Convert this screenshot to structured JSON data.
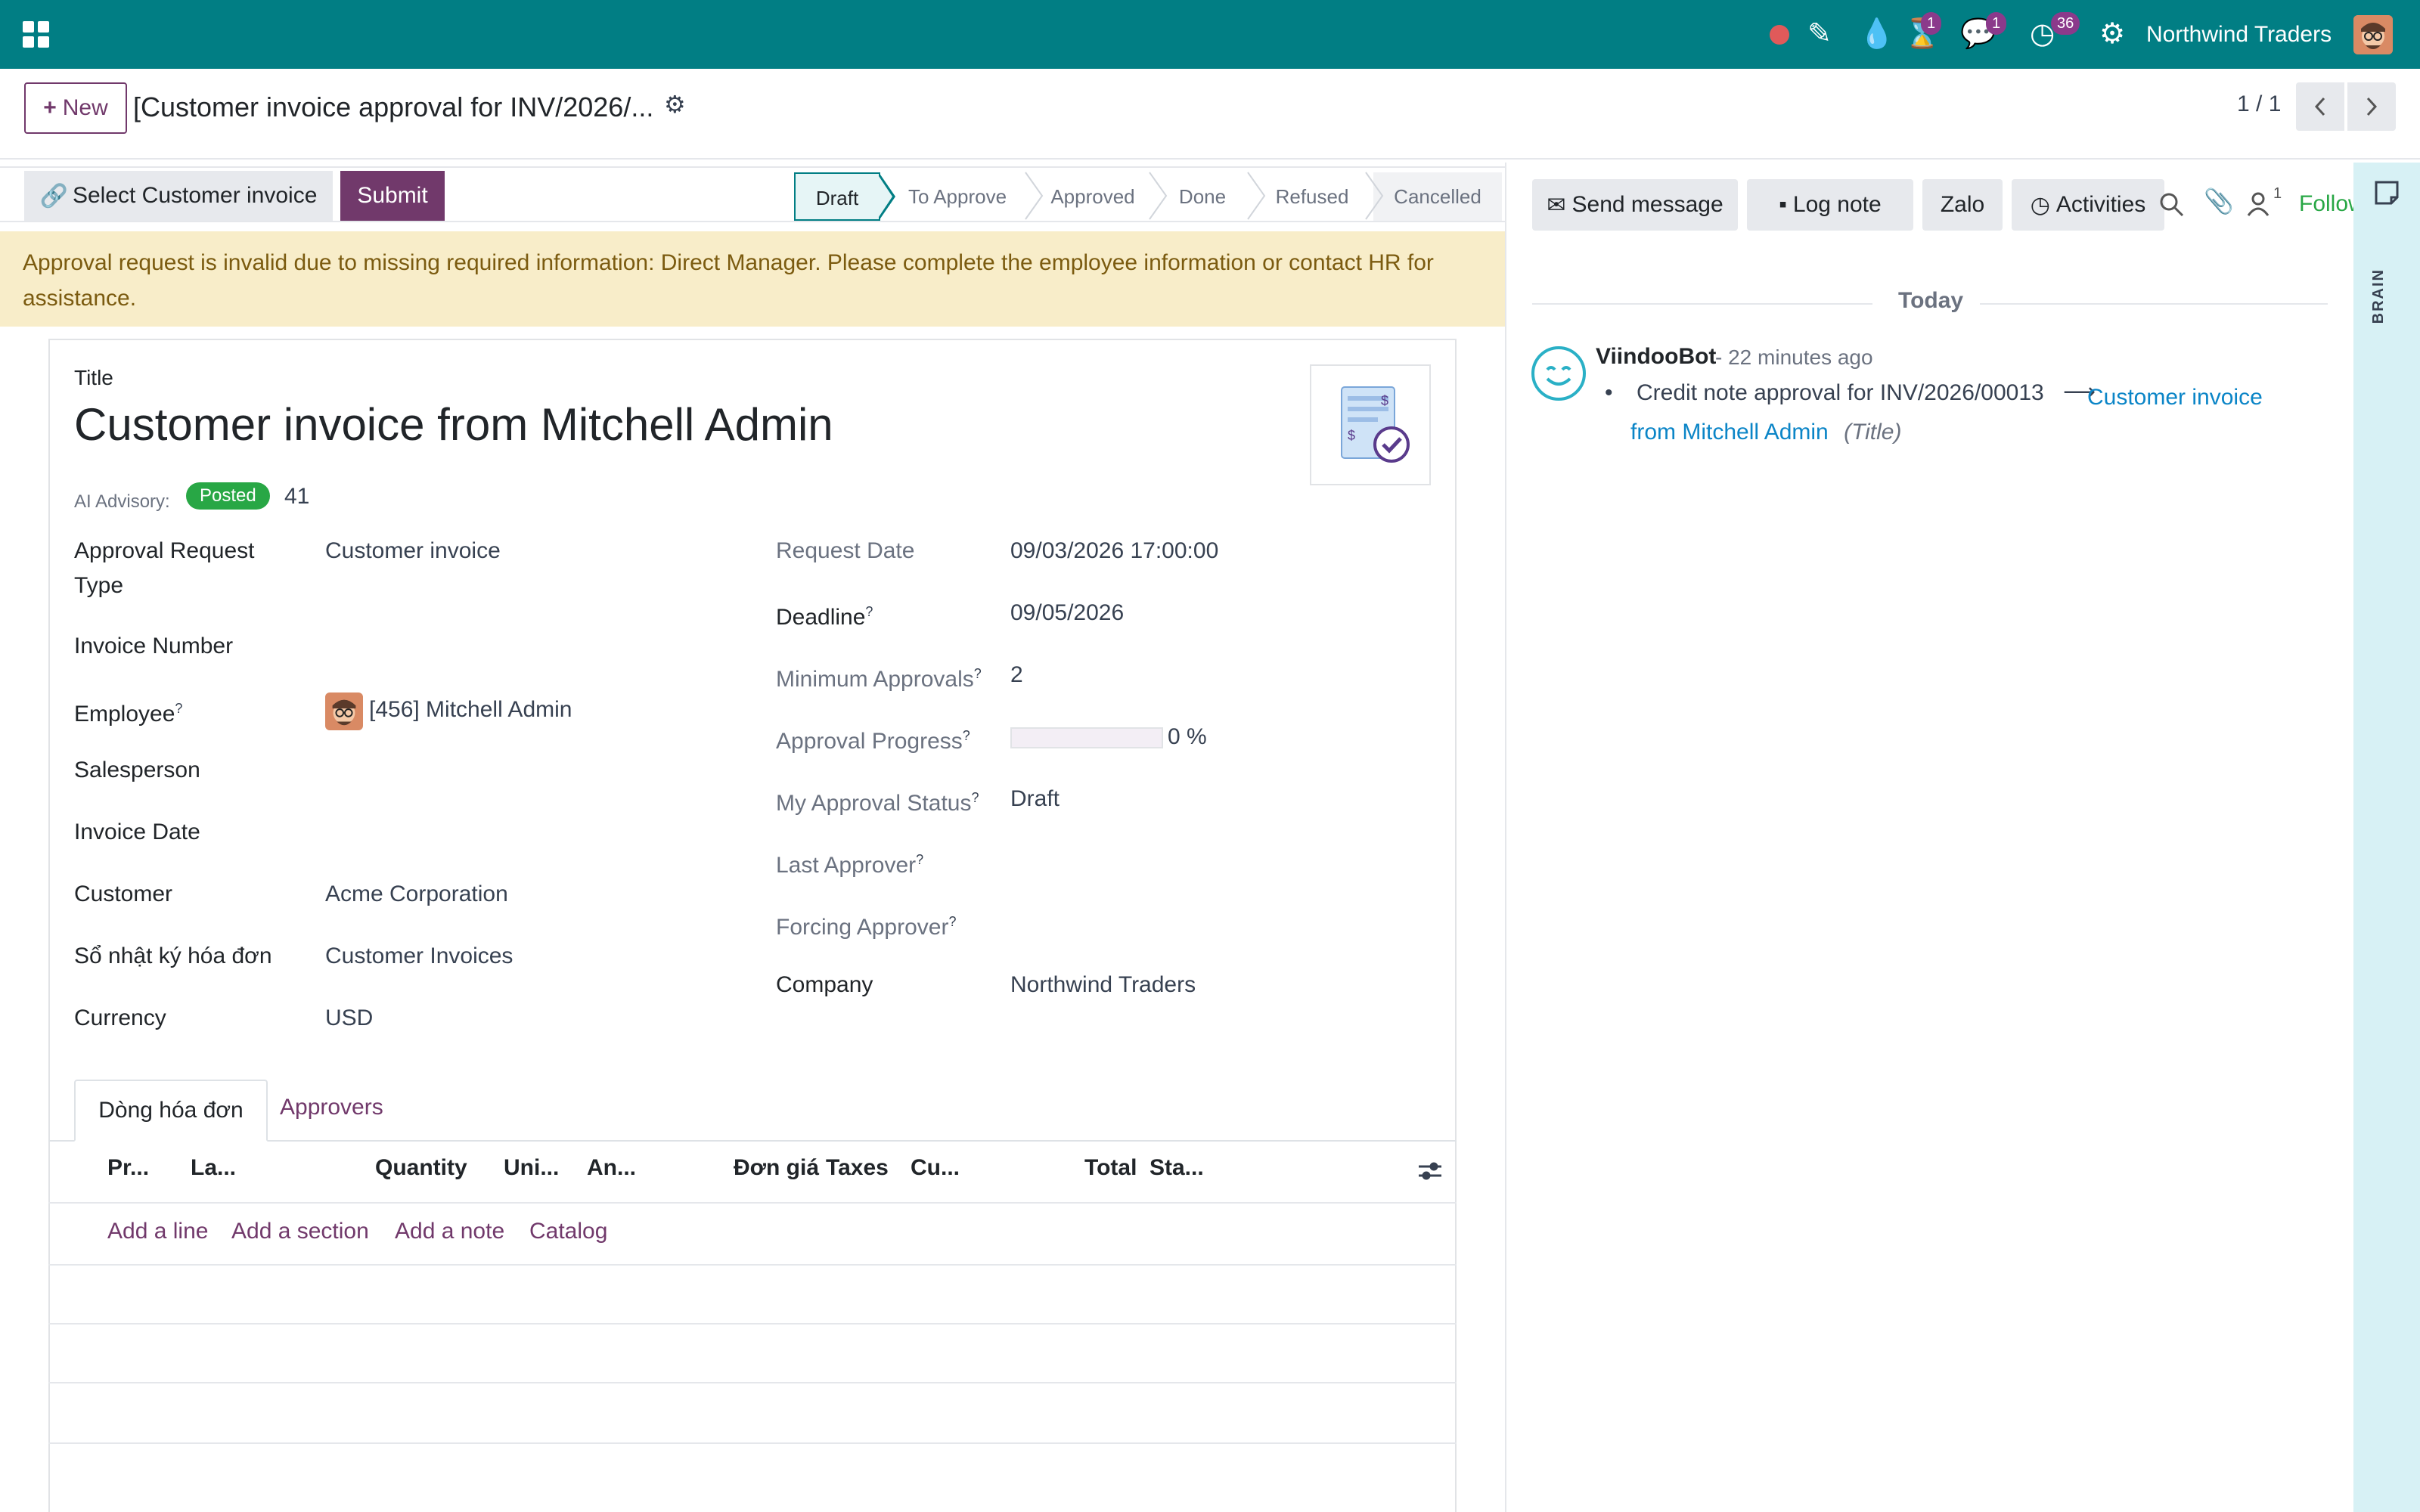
{
  "topbar": {
    "company": "Northwind Traders",
    "badges": {
      "activities_timer": "1",
      "messages": "1",
      "clock": "36"
    },
    "colors": {
      "bar": "#017e84",
      "badge": "#8b3a8b"
    }
  },
  "control_panel": {
    "new_label": "New",
    "breadcrumb": "[Customer invoice approval for INV/2026/...",
    "pager": "1 / 1"
  },
  "actions": {
    "select_label": "Select Customer invoice",
    "submit_label": "Submit"
  },
  "stages": [
    "Draft",
    "To Approve",
    "Approved",
    "Done",
    "Refused",
    "Cancelled"
  ],
  "active_stage": "Draft",
  "alert_text": "Approval request is invalid due to missing required information: Direct Manager. Please complete the employee information or contact HR for assistance.",
  "form": {
    "title_label": "Title",
    "title": "Customer invoice from Mitchell Admin",
    "ai_label": "AI Advisory:",
    "ai_badge": "Posted",
    "ai_score": "41",
    "left": {
      "approval_type_label": "Approval Request Type",
      "approval_type": "Customer invoice",
      "invoice_number_label": "Invoice Number",
      "employee_label": "Employee",
      "employee": "[456] Mitchell Admin",
      "salesperson_label": "Salesperson",
      "invoice_date_label": "Invoice Date",
      "customer_label": "Customer",
      "customer": "Acme Corporation",
      "journal_label": "Sổ nhật ký hóa đơn",
      "journal": "Customer Invoices",
      "currency_label": "Currency",
      "currency": "USD"
    },
    "right": {
      "request_date_label": "Request Date",
      "request_date": "09/03/2026 17:00:00",
      "deadline_label": "Deadline",
      "deadline": "09/05/2026",
      "min_approvals_label": "Minimum Approvals",
      "min_approvals": "2",
      "progress_label": "Approval Progress",
      "progress_value": 0,
      "progress_text": "0 %",
      "my_status_label": "My Approval Status",
      "my_status": "Draft",
      "last_approver_label": "Last Approver",
      "forcing_approver_label": "Forcing Approver",
      "company_label": "Company",
      "company": "Northwind Traders"
    },
    "tabs": [
      "Dòng hóa đơn",
      "Approvers"
    ],
    "columns": [
      "Pr...",
      "La...",
      "Quantity",
      "Uni...",
      "An...",
      "Đơn giá",
      "Taxes",
      "Cu...",
      "Total",
      "Sta..."
    ],
    "add_links": [
      "Add a line",
      "Add a section",
      "Add a note",
      "Catalog"
    ]
  },
  "chatter": {
    "send_message": "Send message",
    "log_note": "Log note",
    "zalo": "Zalo",
    "activities": "Activities",
    "followers_count": "1",
    "follow": "Follow",
    "date_sep": "Today",
    "author": "ViindooBot",
    "time": "- 22 minutes ago",
    "change_old": "Credit note approval for INV/2026/00013",
    "change_new": "Customer invoice from Mitchell Admin",
    "change_field": "(Title)"
  },
  "brain_label": "BRAIN"
}
